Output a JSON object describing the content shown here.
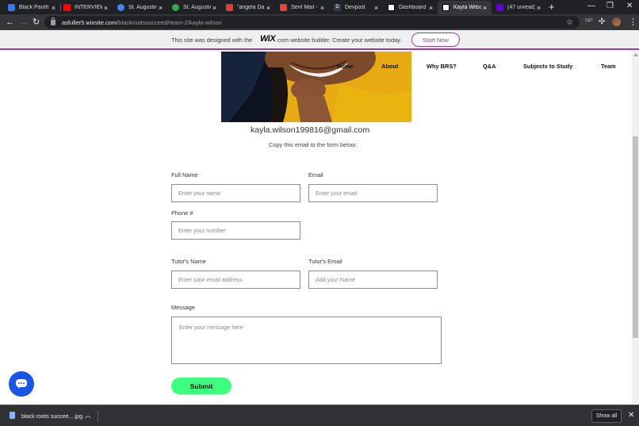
{
  "browser": {
    "tabs": [
      {
        "label": "Black Panth",
        "color": "#3b78e7"
      },
      {
        "label": "INTERVIEW",
        "color": "#ff0000"
      },
      {
        "label": "St. Augustin",
        "color": "#4285f4"
      },
      {
        "label": "St. Augustin",
        "color": "#34a853"
      },
      {
        "label": "\"angela Da",
        "color": "#e53935"
      },
      {
        "label": "Sent Mail -",
        "color": "#ea4335"
      },
      {
        "label": "Devpost",
        "color": "#2c3e50"
      },
      {
        "label": "Dashboard",
        "color": "#000000"
      },
      {
        "label": "Kayla Wilso",
        "color": "#000000",
        "active": true
      },
      {
        "label": "(47 unread)",
        "color": "#6001d2"
      }
    ],
    "url_domain": "asfuller5.wixsite.com",
    "url_path": "/blackrootssucceed/team-2/kayla-wilson",
    "profile_initials": "NP"
  },
  "wix_banner": {
    "text_before": "This site was designed with the",
    "logo": "WiX",
    "text_after": ".com website builder. Create your website today.",
    "cta": "Start Now"
  },
  "nav": {
    "items": [
      "Home",
      "About",
      "Why BRS?",
      "Q&A",
      "Subjects to Study",
      "Team"
    ]
  },
  "profile": {
    "email": "kayla.wilson199816@gmail.com",
    "copy_note": "Copy this email to the form below:"
  },
  "form": {
    "full_name_label": "Full Name",
    "full_name_placeholder": "Enter your name",
    "email_label": "Email",
    "email_placeholder": "Enter your email",
    "phone_label": "Phone #",
    "phone_placeholder": "Enter your number",
    "tutor_name_label": "Tutor's Name",
    "tutor_name_placeholder": "Enter tutor email address",
    "tutor_email_label": "Tutor's Email",
    "tutor_email_placeholder": "Add your Name",
    "message_label": "Message",
    "message_placeholder": "Enter your message here",
    "submit_label": "Submit"
  },
  "download_bar": {
    "file_name": "black roots succee....jpg",
    "show_all": "Show all"
  },
  "colors": {
    "wix_purple": "#9e3ca6",
    "submit_green": "#3dff7e",
    "chat_blue": "#1a55e8"
  }
}
